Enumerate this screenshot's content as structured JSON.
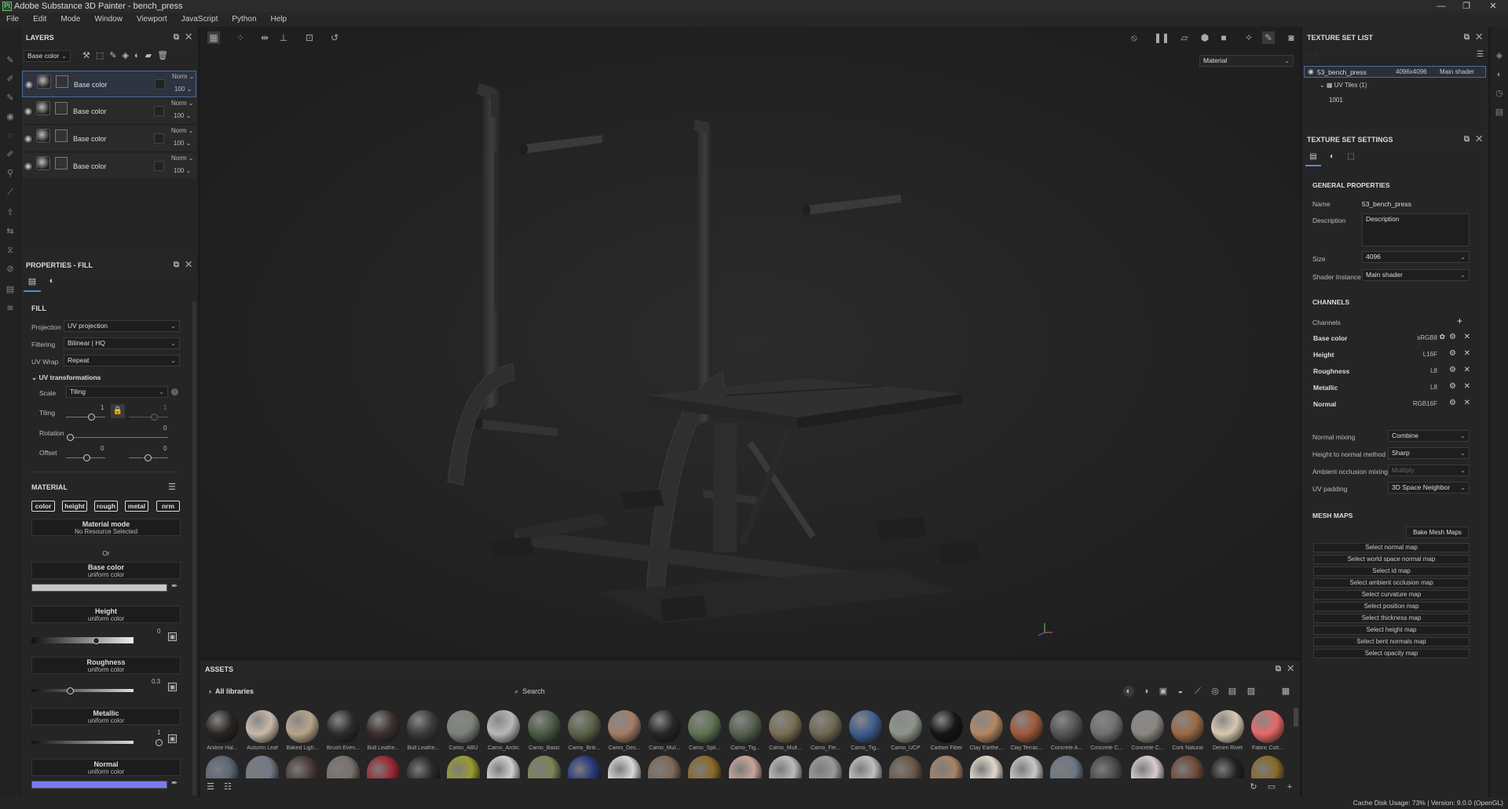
{
  "window": {
    "title": "Adobe Substance 3D Painter - bench_press",
    "controls": [
      "—",
      "❐",
      "✕"
    ]
  },
  "menu": [
    "File",
    "Edit",
    "Mode",
    "Window",
    "Viewport",
    "JavaScript",
    "Python",
    "Help"
  ],
  "layers": {
    "title": "LAYERS",
    "channel_select": "Base color",
    "rows": [
      {
        "name": "Base color",
        "mode": "Norm",
        "opacity": "100"
      },
      {
        "name": "Base color",
        "mode": "Norm",
        "opacity": "100"
      },
      {
        "name": "Base color",
        "mode": "Norm",
        "opacity": "100"
      },
      {
        "name": "Base color",
        "mode": "Norm",
        "opacity": "100"
      }
    ]
  },
  "properties": {
    "title": "PROPERTIES - FILL",
    "fill_label": "FILL",
    "projection_label": "Projection",
    "projection": "UV projection",
    "filtering_label": "Filtering",
    "filtering": "Bilinear | HQ",
    "uvwrap_label": "UV Wrap",
    "uvwrap": "Repeat",
    "uv_transform_label": "UV transformations",
    "scale_label": "Scale",
    "scale": "Tiling",
    "tiling_label": "Tiling",
    "tiling_u": "1",
    "tiling_v": "1",
    "rotation_label": "Rotation",
    "rotation": "0",
    "offset_label": "Offset",
    "offset_u": "0",
    "offset_v": "0",
    "material_label": "MATERIAL",
    "chips": [
      "color",
      "height",
      "rough",
      "metal",
      "nrm"
    ],
    "material_mode": "Material mode",
    "material_mode_sub": "No Resource Selected",
    "or": "Or",
    "base_color": "Base color",
    "base_color_sub": "uniform color",
    "base_color_value": "#c8c8c8",
    "height": "Height",
    "height_sub": "uniform color",
    "height_value": "0",
    "roughness": "Roughness",
    "roughness_sub": "uniform color",
    "roughness_value": "0.3",
    "metallic": "Metallic",
    "metallic_sub": "uniform color",
    "metallic_value": "1",
    "normal": "Normal",
    "normal_sub": "uniform color",
    "normal_value": "#7b7bf0"
  },
  "viewport": {
    "mode": "Material"
  },
  "texture_set_list": {
    "title": "TEXTURE SET LIST",
    "set_name": "53_bench_press",
    "set_res": "4096x4096",
    "set_shader": "Main shader",
    "uv_tiles": "UV Tiles (1)",
    "tile": "1001"
  },
  "texture_set_settings": {
    "title": "TEXTURE SET SETTINGS",
    "general": "GENERAL PROPERTIES",
    "name_label": "Name",
    "name": "53_bench_press",
    "desc_label": "Description",
    "desc": "Description",
    "size_label": "Size",
    "size": "4096",
    "shader_label": "Shader Instance",
    "shader": "Main shader",
    "channels_title": "CHANNELS",
    "channels_label": "Channels",
    "channels": [
      {
        "name": "Base color",
        "format": "sRGB8"
      },
      {
        "name": "Height",
        "format": "L16F"
      },
      {
        "name": "Roughness",
        "format": "L8"
      },
      {
        "name": "Metallic",
        "format": "L8"
      },
      {
        "name": "Normal",
        "format": "RGB16F"
      }
    ],
    "normal_mixing_label": "Normal mixing",
    "normal_mixing": "Combine",
    "h2n_label": "Height to normal method",
    "h2n": "Sharp",
    "ao_label": "Ambient occlusion mixing",
    "ao": "Multiply",
    "uvpad_label": "UV padding",
    "uvpad": "3D Space Neighbor",
    "mesh_maps": "MESH MAPS",
    "bake": "Bake Mesh Maps",
    "maps": [
      "Select normal map",
      "Select world space normal map",
      "Select id map",
      "Select ambient occlusion map",
      "Select curvature map",
      "Select position map",
      "Select thickness map",
      "Select height map",
      "Select bent normals map",
      "Select opacity map"
    ]
  },
  "assets": {
    "title": "ASSETS",
    "library": "All libraries",
    "search": "Search",
    "row1": [
      {
        "name": "Aniline Hal...",
        "color": "#2a2522"
      },
      {
        "name": "Autumn Leaf",
        "color": "#c9b8a8"
      },
      {
        "name": "Baked Ligh...",
        "color": "#b8a58a"
      },
      {
        "name": "Brush Even...",
        "color": "#2b2b2b"
      },
      {
        "name": "Bull Leathe...",
        "color": "#3a302c"
      },
      {
        "name": "Bull Leathe...",
        "color": "#3a3a3a"
      },
      {
        "name": "Camo_ABU",
        "color": "#7d8278"
      },
      {
        "name": "Camo_Arctic",
        "color": "#b8b8b8"
      },
      {
        "name": "Camo_Basic",
        "color": "#4b5a44"
      },
      {
        "name": "Camo_Briti...",
        "color": "#5a6248"
      },
      {
        "name": "Camo_Des...",
        "color": "#a27c68"
      },
      {
        "name": "Camo_Mul...",
        "color": "#262626"
      },
      {
        "name": "Camo_Spli...",
        "color": "#5f7252"
      },
      {
        "name": "Camo_Tig...",
        "color": "#55604e"
      },
      {
        "name": "Camo_Mult...",
        "color": "#7a6e52"
      },
      {
        "name": "Camo_Fle...",
        "color": "#6e6850"
      },
      {
        "name": "Camo_Tig...",
        "color": "#3e5c8e"
      },
      {
        "name": "Camo_UCP",
        "color": "#8d948a"
      },
      {
        "name": "Carbon Fiber",
        "color": "#151515"
      },
      {
        "name": "Clay Earthe...",
        "color": "#b38763"
      },
      {
        "name": "Clay Terrac...",
        "color": "#9e5a3c"
      },
      {
        "name": "Concrete A...",
        "color": "#555"
      },
      {
        "name": "Concrete C...",
        "color": "#6f6f6f"
      },
      {
        "name": "Concrete C...",
        "color": "#8a8780"
      },
      {
        "name": "Cork Natural",
        "color": "#9a6a44"
      },
      {
        "name": "Denim Rivet",
        "color": "#d8c8b0"
      },
      {
        "name": "Fabric Cott...",
        "color": "#e46a6a"
      }
    ],
    "row2": [
      "#5a6676",
      "#707a86",
      "#4a3a38",
      "#7a7068",
      "#9c2834",
      "#2a2a2a",
      "#9a9a30",
      "#cfcfcf",
      "#7a8456",
      "#283a7e",
      "#d8d8d8",
      "#7e6a58",
      "#8a6a28",
      "#c9a49a",
      "#bcbcbc",
      "#9a9a9a",
      "#c0c0c0",
      "#6a5848",
      "#a88466",
      "#e0d8cc",
      "#c8c8c8",
      "#6e7886",
      "#4a4a4a",
      "#d8cccc",
      "#704a3a",
      "#222",
      "#8a6a2a"
    ]
  },
  "status": {
    "text": "Cache Disk Usage:  73% | Version: 9.0.0 (OpenGL)"
  }
}
